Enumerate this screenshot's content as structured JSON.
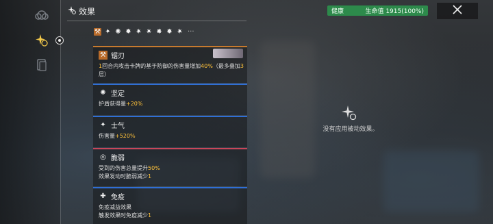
{
  "header": {
    "title": "效果"
  },
  "status": {
    "condition": "健康",
    "hp_label": "生命值 1915(100%)",
    "accent": "#2d8a4b"
  },
  "empty_state": {
    "text": "没有应用被动效果。"
  },
  "icon_strip": {
    "more": "···"
  },
  "effects": [
    {
      "name": "锯刃",
      "icon": "saw-blade-icon",
      "bar_color": "#c77a2e",
      "desc_parts": [
        "1",
        "回合内攻击卡牌的基于防御的伤害量增加",
        "40%",
        "（最多叠加",
        "3",
        "层）"
      ]
    },
    {
      "name": "坚定",
      "icon": "shield-burst-icon",
      "bar_color": "#2f6fd6",
      "desc_parts": [
        "护盾获得量",
        "+20%"
      ]
    },
    {
      "name": "士气",
      "icon": "morale-icon",
      "bar_color": "#2f6fd6",
      "desc_parts": [
        "伤害量",
        "+520%"
      ]
    },
    {
      "name": "脆弱",
      "icon": "target-icon",
      "bar_color": "#c9465a",
      "desc_parts": [
        "受到的伤害总量提升",
        "50%",
        "效果发动时脆弱减少",
        "1"
      ]
    },
    {
      "name": "免疫",
      "icon": "immune-icon",
      "bar_color": "#2f6fd6",
      "desc_parts": [
        "免疫减益效果",
        "触发效果时免疫减少",
        "1"
      ]
    }
  ]
}
